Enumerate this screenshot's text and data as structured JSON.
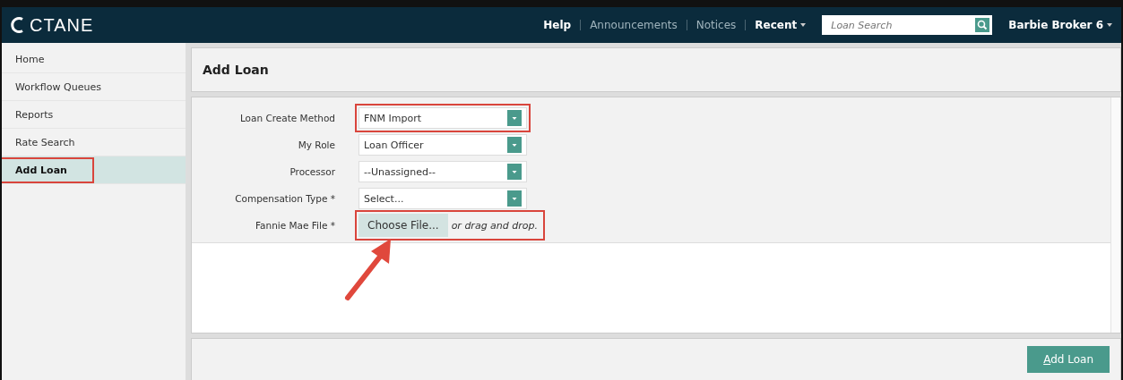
{
  "topbar": {
    "logo": "CTANE",
    "links": [
      {
        "label": "Help",
        "bold": true
      },
      {
        "label": "Announcements",
        "bold": false
      },
      {
        "label": "Notices",
        "bold": false
      }
    ],
    "recent": "Recent",
    "search": {
      "placeholder": "Loan Search"
    },
    "user": "Barbie Broker 6"
  },
  "sidebar": {
    "items": [
      {
        "label": "Home",
        "selected": false,
        "highlighted": false
      },
      {
        "label": "Workflow Queues",
        "selected": false,
        "highlighted": false
      },
      {
        "label": "Reports",
        "selected": false,
        "highlighted": false
      },
      {
        "label": "Rate Search",
        "selected": false,
        "highlighted": false
      },
      {
        "label": "Add Loan",
        "selected": true,
        "highlighted": true
      }
    ]
  },
  "page_title": "Add Loan",
  "form": {
    "fields": [
      {
        "kind": "select",
        "label": "Loan Create Method",
        "value": "FNM Import",
        "highlighted": true
      },
      {
        "kind": "select",
        "label": "My Role",
        "value": "Loan Officer",
        "highlighted": false
      },
      {
        "kind": "select",
        "label": "Processor",
        "value": "--Unassigned--",
        "highlighted": false
      },
      {
        "kind": "select",
        "label": "Compensation Type *",
        "value": "Select...",
        "highlighted": false
      },
      {
        "kind": "file",
        "label": "Fannie Mae File *",
        "button": "Choose File...",
        "hint": "or drag and drop.",
        "highlighted": true
      }
    ]
  },
  "submit_button": "Add Loan"
}
